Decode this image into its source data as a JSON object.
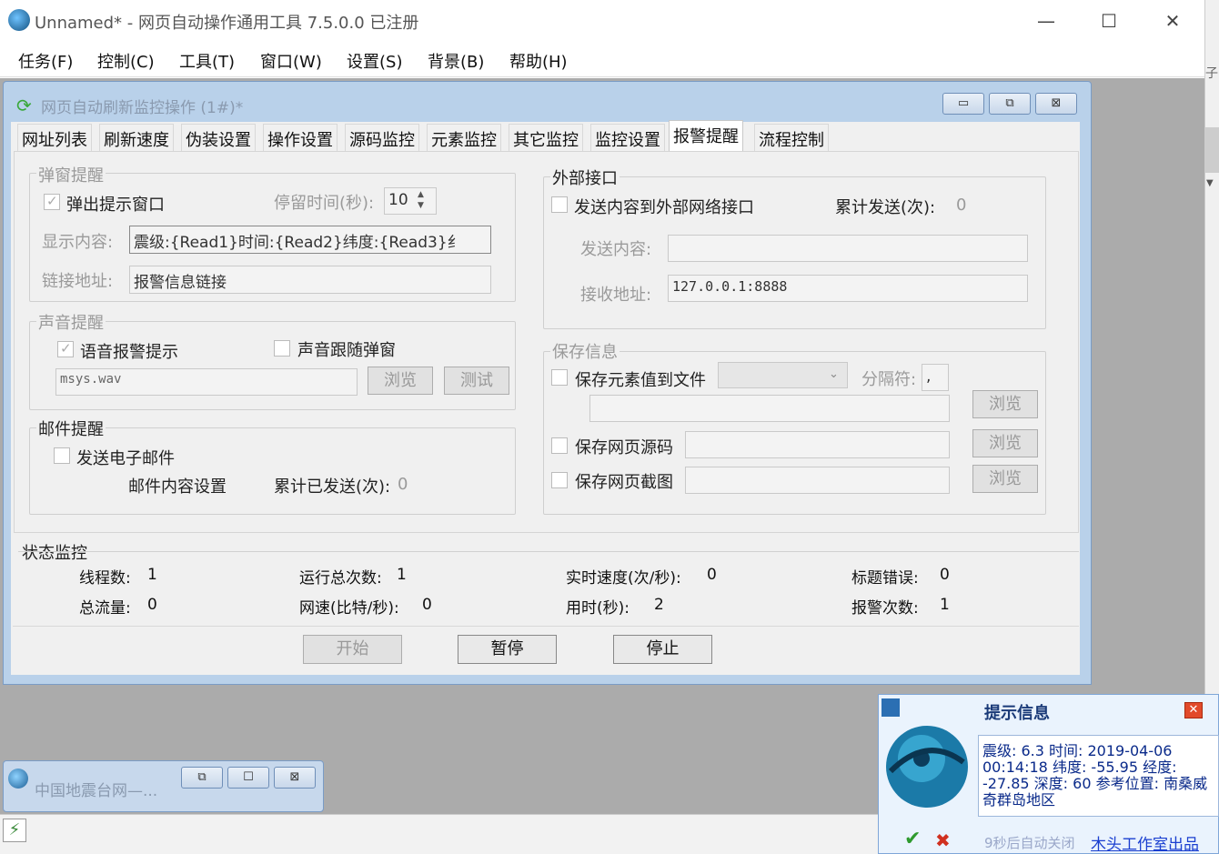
{
  "app": {
    "title": "Unnamed* - 网页自动操作通用工具 7.5.0.0  已注册",
    "minimize_glyph": "—",
    "maximize_glyph": "☐",
    "close_glyph": "✕"
  },
  "menu": [
    "任务(F)",
    "控制(C)",
    "工具(T)",
    "窗口(W)",
    "设置(S)",
    "背景(B)",
    "帮助(H)"
  ],
  "right_edge_char": "子",
  "child_window": {
    "title": "网页自动刷新监控操作  (1#)*",
    "min_glyph": "▭",
    "restore_glyph": "⧉",
    "close_glyph": "⊠"
  },
  "tabs": [
    "网址列表",
    "刷新速度",
    "伪装设置",
    "操作设置",
    "源码监控",
    "元素监控",
    "其它监控",
    "监控设置",
    "报警提醒",
    "流程控制"
  ],
  "popup_alert": {
    "group": "弹窗提醒",
    "checkbox": "弹出提示窗口",
    "stay_label": "停留时间(秒):",
    "stay_value": "10",
    "display_label": "显示内容:",
    "display_value": "震级:{Read1}时间:{Read2}纬度:{Read3}纟",
    "link_label": "链接地址:",
    "link_value": "报警信息链接"
  },
  "sound_alert": {
    "group": "声音提醒",
    "voice_checkbox": "语音报警提示",
    "follow_checkbox": "声音跟随弹窗",
    "file": "msys.wav",
    "browse": "浏览",
    "test": "测试"
  },
  "mail_alert": {
    "group": "邮件提醒",
    "checkbox": "发送电子邮件",
    "settings": "邮件内容设置",
    "sent_label": "累计已发送(次):",
    "sent_value": "0"
  },
  "external": {
    "group": "外部接口",
    "checkbox": "发送内容到外部网络接口",
    "sent_label": "累计发送(次):",
    "sent_value": "0",
    "content_label": "发送内容:",
    "recv_label": "接收地址:",
    "recv_value": "127.0.0.1:8888"
  },
  "save_info": {
    "group": "保存信息",
    "save_elem": "保存元素值到文件",
    "separator_label": "分隔符:",
    "separator_value": ",",
    "browse": "浏览",
    "save_src": "保存网页源码",
    "save_shot": "保存网页截图"
  },
  "status": {
    "group": "状态监控",
    "items": [
      {
        "label": "线程数:",
        "value": "1"
      },
      {
        "label": "运行总次数:",
        "value": "1"
      },
      {
        "label": "实时速度(次/秒):",
        "value": "0"
      },
      {
        "label": "标题错误:",
        "value": "0"
      },
      {
        "label": "总流量:",
        "value": "0"
      },
      {
        "label": "网速(比特/秒):",
        "value": "0"
      },
      {
        "label": "用时(秒):",
        "value": "2"
      },
      {
        "label": "报警次数:",
        "value": "1"
      }
    ]
  },
  "buttons": {
    "start": "开始",
    "pause": "暂停",
    "stop": "停止"
  },
  "minimized_window": {
    "title": "中国地震台网—..."
  },
  "notification": {
    "title": "提示信息",
    "message": "震级: 6.3 时间: 2019-04-06 00:14:18 纬度: -55.95 经度: -27.85 深度: 60 参考位置: 南桑威奇群岛地区",
    "auto_close": "9秒后自动关闭",
    "footer": "木头工作室出品"
  }
}
